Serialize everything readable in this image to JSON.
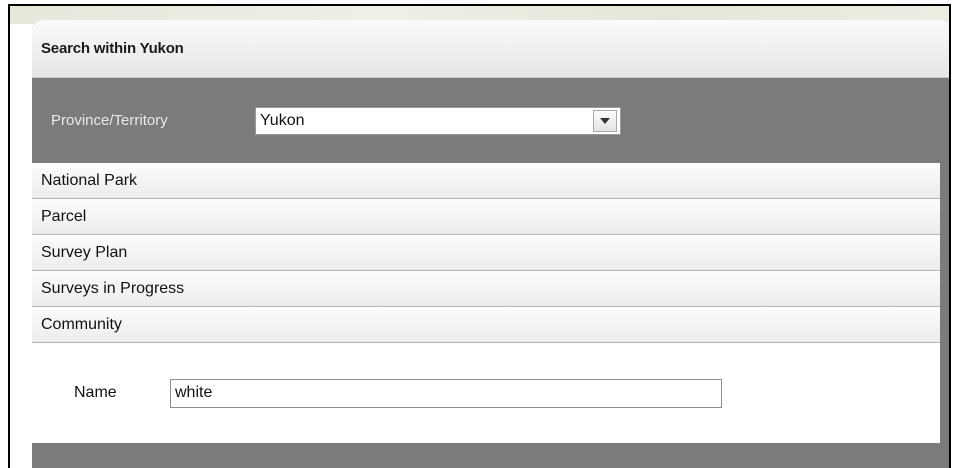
{
  "panel": {
    "title": "Search within Yukon"
  },
  "province": {
    "label": "Province/Territory",
    "selected": "Yukon"
  },
  "accordion": {
    "items": [
      {
        "label": "National Park"
      },
      {
        "label": "Parcel"
      },
      {
        "label": "Survey Plan"
      },
      {
        "label": "Surveys in Progress"
      },
      {
        "label": "Community"
      }
    ]
  },
  "community": {
    "name_label": "Name",
    "name_value": "white"
  },
  "colors": {
    "panel_background": "#7b7b7b",
    "header_background": "#f0f0f0"
  },
  "icons": {
    "dropdown": "chevron-down-icon"
  }
}
